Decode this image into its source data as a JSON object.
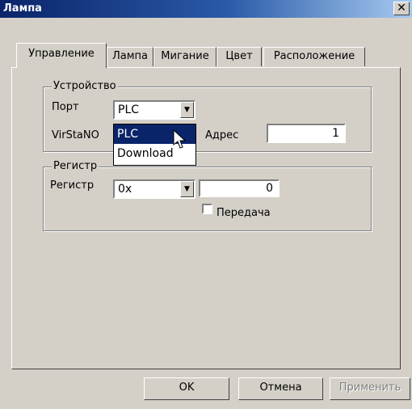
{
  "window": {
    "title": "Лампа",
    "close_glyph": "✕"
  },
  "tabs": [
    {
      "label": "Управление",
      "active": true
    },
    {
      "label": "Лампа"
    },
    {
      "label": "Мигание"
    },
    {
      "label": "Цвет"
    },
    {
      "label": "Расположение"
    }
  ],
  "device_group": {
    "legend": "Устройство",
    "port_label": "Порт",
    "port_value": "PLC",
    "virsta_label": "VirStaNO",
    "address_label": "Адрес",
    "address_value": "1"
  },
  "port_dropdown": {
    "options": [
      "PLC",
      "Download"
    ],
    "selected": "PLC"
  },
  "register_group": {
    "legend": "Регистр",
    "register_label": "Регистр",
    "type_value": "0x",
    "register_value": "0",
    "checkbox_label": "Передача"
  },
  "buttons": {
    "ok": "OK",
    "cancel": "Отмена",
    "apply": "Применить"
  }
}
